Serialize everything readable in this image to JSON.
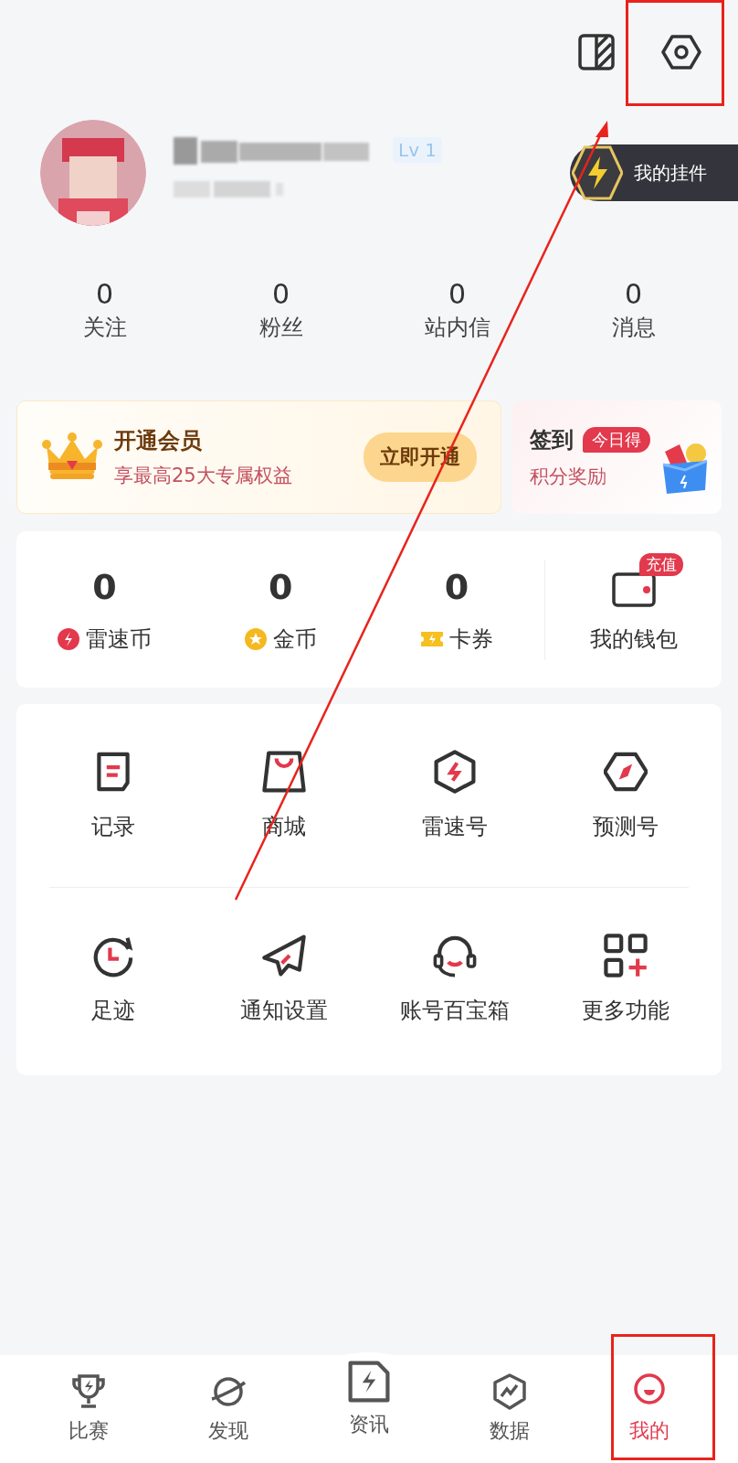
{
  "profile": {
    "level": "Lv 1",
    "widget_button": "我的挂件"
  },
  "stats": [
    {
      "value": "0",
      "label": "关注"
    },
    {
      "value": "0",
      "label": "粉丝"
    },
    {
      "value": "0",
      "label": "站内信"
    },
    {
      "value": "0",
      "label": "消息"
    }
  ],
  "vip_card": {
    "title": "开通会员",
    "subtitle": "享最高25大专属权益",
    "button": "立即开通"
  },
  "checkin_card": {
    "title": "签到",
    "badge": "今日得",
    "subtitle": "积分奖励"
  },
  "wallet": {
    "balances": [
      {
        "value": "0",
        "label": "雷速币"
      },
      {
        "value": "0",
        "label": "金币"
      },
      {
        "value": "0",
        "label": "卡券"
      }
    ],
    "wallet_label": "我的钱包",
    "wallet_badge": "充值"
  },
  "functions": [
    [
      {
        "label": "记录"
      },
      {
        "label": "商城"
      },
      {
        "label": "雷速号"
      },
      {
        "label": "预测号"
      }
    ],
    [
      {
        "label": "足迹"
      },
      {
        "label": "通知设置"
      },
      {
        "label": "账号百宝箱"
      },
      {
        "label": "更多功能"
      }
    ]
  ],
  "bottom_nav": [
    {
      "label": "比赛",
      "selected": false
    },
    {
      "label": "发现",
      "selected": false
    },
    {
      "label": "资讯",
      "selected": false
    },
    {
      "label": "数据",
      "selected": false
    },
    {
      "label": "我的",
      "selected": true
    }
  ]
}
